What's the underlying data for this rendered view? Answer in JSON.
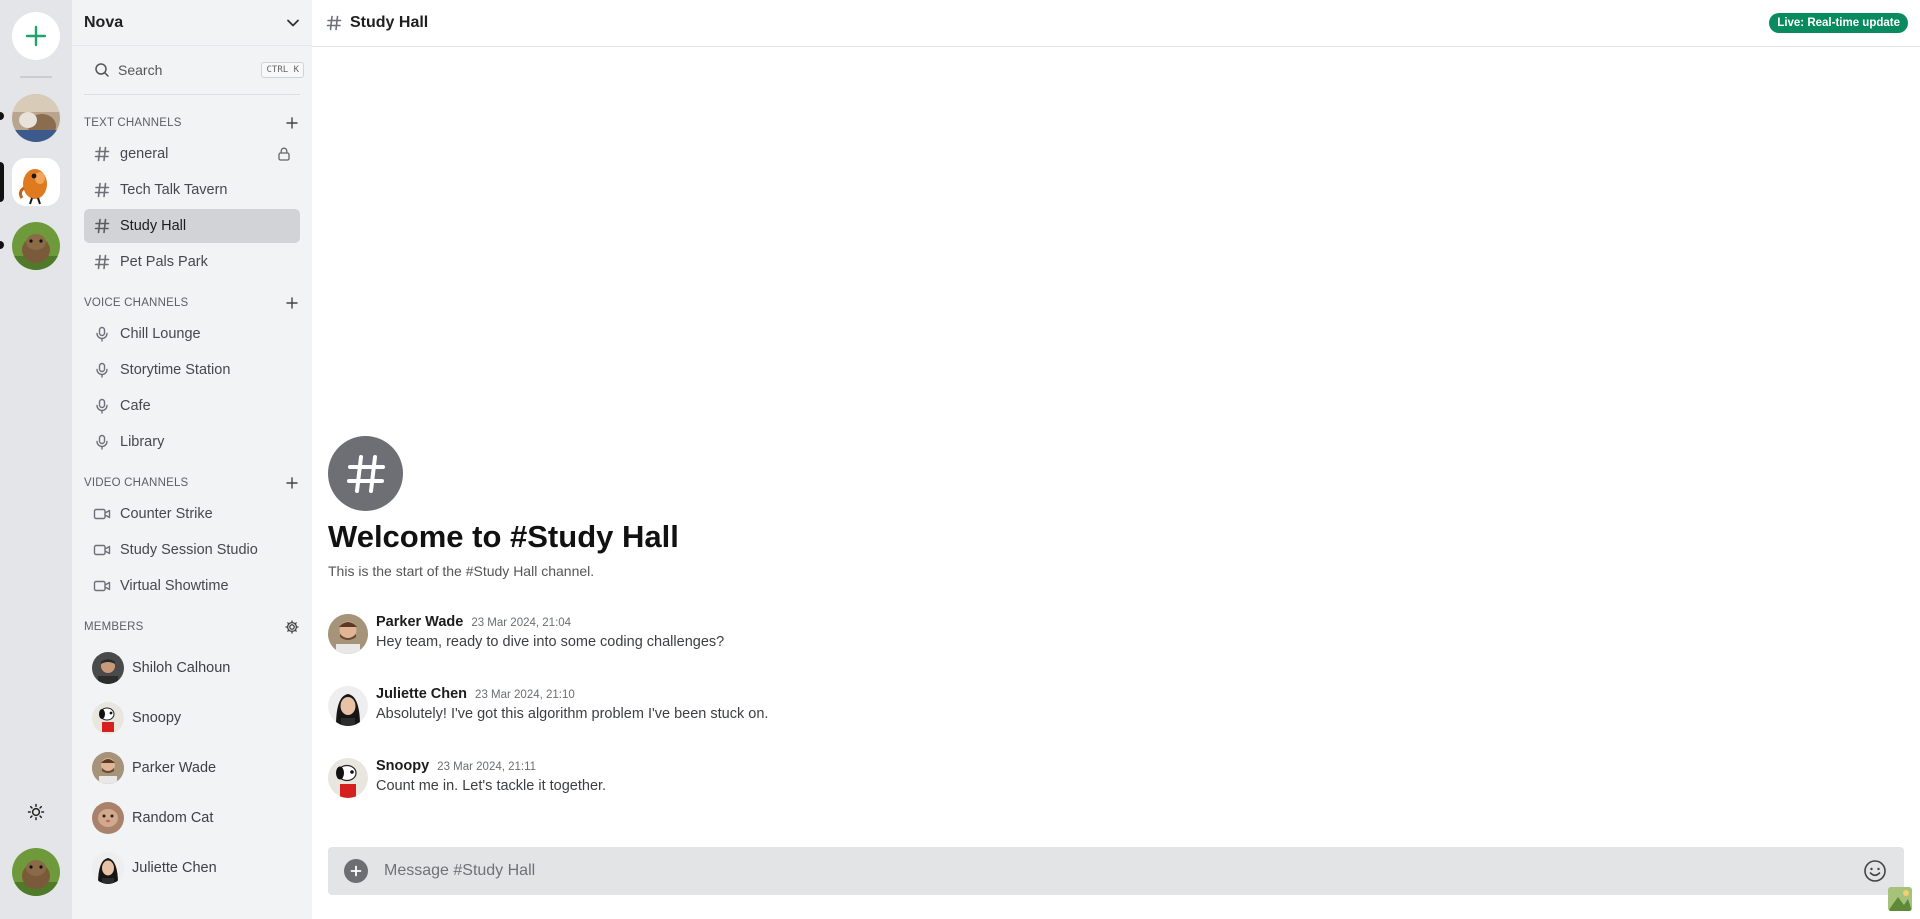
{
  "app": {
    "server_name": "Nova",
    "live_badge": "Live: Real-time update",
    "accent_color": "#0a8a5f"
  },
  "rail": {
    "add_icon": "plus-icon",
    "theme_icon": "sun-icon",
    "servers": [
      {
        "name": "server-1"
      },
      {
        "name": "server-2"
      },
      {
        "name": "server-3"
      }
    ]
  },
  "sidebar": {
    "search_label": "Search",
    "search_shortcut": "CTRL K",
    "text_channels_title": "TEXT CHANNELS",
    "text_channels": [
      {
        "label": "general",
        "locked": true
      },
      {
        "label": "Tech Talk Tavern"
      },
      {
        "label": "Study Hall",
        "active": true
      },
      {
        "label": "Pet Pals Park"
      }
    ],
    "voice_channels_title": "VOICE CHANNELS",
    "voice_channels": [
      {
        "label": "Chill Lounge"
      },
      {
        "label": "Storytime Station"
      },
      {
        "label": "Cafe"
      },
      {
        "label": "Library"
      }
    ],
    "video_channels_title": "VIDEO CHANNELS",
    "video_channels": [
      {
        "label": "Counter Strike"
      },
      {
        "label": "Study Session Studio"
      },
      {
        "label": "Virtual Showtime"
      }
    ],
    "members_title": "MEMBERS",
    "members": [
      {
        "name": "Shiloh Calhoun"
      },
      {
        "name": "Snoopy"
      },
      {
        "name": "Parker Wade"
      },
      {
        "name": "Random Cat"
      },
      {
        "name": "Juliette Chen"
      }
    ]
  },
  "channel": {
    "name": "Study Hall",
    "welcome_title": "Welcome to #Study Hall",
    "welcome_subtitle": "This is the start of the #Study Hall channel."
  },
  "messages": [
    {
      "author": "Parker Wade",
      "time": "23 Mar 2024, 21:04",
      "text": "Hey team, ready to dive into some coding challenges?"
    },
    {
      "author": "Juliette Chen",
      "time": "23 Mar 2024, 21:10",
      "text": "Absolutely! I've got this algorithm problem I've been stuck on."
    },
    {
      "author": "Snoopy",
      "time": "23 Mar 2024, 21:11",
      "text": "Count me in. Let's tackle it together."
    }
  ],
  "composer": {
    "placeholder": "Message #Study Hall"
  }
}
